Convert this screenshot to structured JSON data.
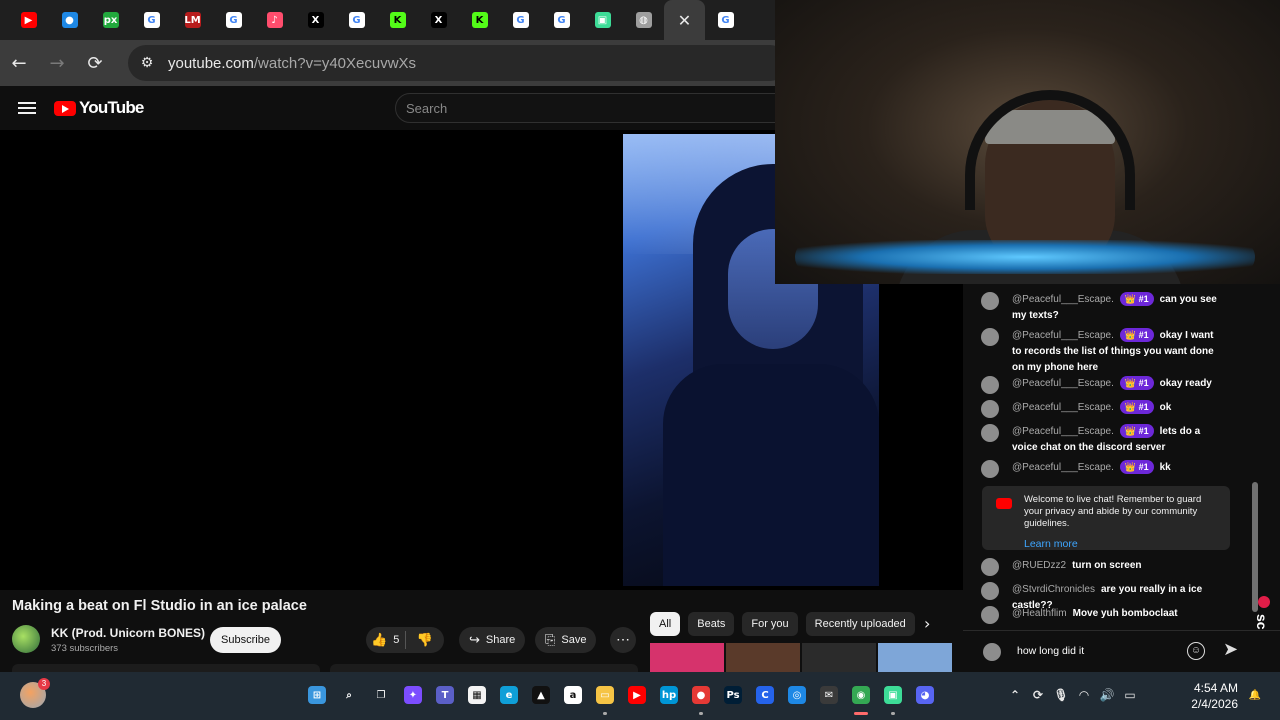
{
  "browser": {
    "tabs": [
      {
        "icon": "youtube-icon",
        "color": "#ff0000",
        "glyph": "▶"
      },
      {
        "icon": "edge-icon",
        "color": "#1e88e5",
        "glyph": "●"
      },
      {
        "icon": "pixlr-icon",
        "color": "#22a93d",
        "glyph": "px"
      },
      {
        "icon": "google-icon",
        "color": "#ffffff",
        "glyph": "G"
      },
      {
        "icon": "lm-icon",
        "color": "#b71c1c",
        "glyph": "LM"
      },
      {
        "icon": "google-icon",
        "color": "#ffffff",
        "glyph": "G"
      },
      {
        "icon": "audio-app-icon",
        "color": "#ff4d6d",
        "glyph": "♪"
      },
      {
        "icon": "x-icon",
        "color": "#000000",
        "glyph": "X"
      },
      {
        "icon": "google-icon",
        "color": "#ffffff",
        "glyph": "G"
      },
      {
        "icon": "kick-icon",
        "color": "#53fc18",
        "glyph": "K"
      },
      {
        "icon": "x-icon",
        "color": "#000000",
        "glyph": "X"
      },
      {
        "icon": "kick-icon",
        "color": "#53fc18",
        "glyph": "K"
      },
      {
        "icon": "google-icon",
        "color": "#ffffff",
        "glyph": "G"
      },
      {
        "icon": "google-icon",
        "color": "#ffffff",
        "glyph": "G"
      },
      {
        "icon": "app-icon",
        "color": "#3ddc97",
        "glyph": "▣"
      },
      {
        "icon": "globe-icon",
        "color": "#9e9e9e",
        "glyph": "◍"
      },
      {
        "icon": "google-icon",
        "color": "#ffffff",
        "glyph": "G"
      }
    ],
    "active_tab_close": "✕",
    "url_domain": "youtube.com",
    "url_path": "/watch?v=y40XecuvwXs"
  },
  "youtube": {
    "logo_text": "YouTube",
    "search_placeholder": "Search"
  },
  "video": {
    "title": "Making a beat on Fl Studio in an ice palace",
    "channel": "KK (Prod. Unicorn BONES)",
    "subscribers": "373 subscribers",
    "subscribe_label": "Subscribe",
    "likes": "5",
    "share_label": "Share",
    "save_label": "Save",
    "more_label": "⋯"
  },
  "recommendations": {
    "chips": [
      "All",
      "Beats",
      "For you",
      "Recently uploaded"
    ],
    "thumb_colors": [
      "#d6336c",
      "#5a3a2a",
      "#2b2b2b",
      "#7ea6d8"
    ]
  },
  "chat": {
    "messages": [
      {
        "author": "@Peaceful___Escape.",
        "badge": "👑 #1",
        "text": "can you see my texts?"
      },
      {
        "author": "@Peaceful___Escape.",
        "badge": "👑 #1",
        "text": "okay I want to records the list of things you want done on my phone here"
      },
      {
        "author": "@Peaceful___Escape.",
        "badge": "👑 #1",
        "text": "okay ready"
      },
      {
        "author": "@Peaceful___Escape.",
        "badge": "👑 #1",
        "text": "ok"
      },
      {
        "author": "@Peaceful___Escape.",
        "badge": "👑 #1",
        "text": "lets do a voice chat on the discord server"
      },
      {
        "author": "@Peaceful___Escape.",
        "badge": "👑 #1",
        "text": "kk"
      },
      {
        "author": "@RUEDzz2",
        "badge": "",
        "text": "turn on screen"
      },
      {
        "author": "@StvrdiChronicles",
        "badge": "",
        "text": "are you really in a ice castle??"
      },
      {
        "author": "@Healthflim",
        "badge": "",
        "text": "Move yuh bomboclaat"
      }
    ],
    "welcome_text": "Welcome to live chat! Remember to guard your privacy and abide by our community guidelines.",
    "learn_more": "Learn more",
    "input_value": "how long did it"
  },
  "overlay": {
    "screenrec_label": "screenrec"
  },
  "taskbar": {
    "weather_badge": "3",
    "time": "4:54 AM",
    "date": "2/4/2026",
    "icons": [
      {
        "name": "start-icon",
        "color": "#3a96dd",
        "glyph": "⊞"
      },
      {
        "name": "search-icon",
        "color": "transparent",
        "glyph": "⌕"
      },
      {
        "name": "task-view-icon",
        "color": "transparent",
        "glyph": "❐"
      },
      {
        "name": "copilot-icon",
        "color": "#7c4dff",
        "glyph": "✦"
      },
      {
        "name": "teams-icon",
        "color": "#5b5fc7",
        "glyph": "T"
      },
      {
        "name": "store-icon",
        "color": "#f4f4f4",
        "glyph": "▦"
      },
      {
        "name": "edge-icon",
        "color": "#0f9fd8",
        "glyph": "e"
      },
      {
        "name": "app-icon",
        "color": "#111111",
        "glyph": "▲"
      },
      {
        "name": "amazon-icon",
        "color": "#ffffff",
        "glyph": "a"
      },
      {
        "name": "file-explorer-icon",
        "color": "#f6c445",
        "glyph": "▭"
      },
      {
        "name": "youtube-icon",
        "color": "#ff0000",
        "glyph": "▶"
      },
      {
        "name": "hp-icon",
        "color": "#0096d6",
        "glyph": "hp"
      },
      {
        "name": "app-icon",
        "color": "#e53935",
        "glyph": "●"
      },
      {
        "name": "photoshop-icon",
        "color": "#001e36",
        "glyph": "Ps"
      },
      {
        "name": "app-icon",
        "color": "#2563eb",
        "glyph": "C"
      },
      {
        "name": "app-icon",
        "color": "#1e88e5",
        "glyph": "◎"
      },
      {
        "name": "app-icon",
        "color": "#3a3a3a",
        "glyph": "✉"
      },
      {
        "name": "chrome-icon",
        "color": "#34a853",
        "glyph": "◉"
      },
      {
        "name": "app-icon",
        "color": "#3ddc97",
        "glyph": "▣"
      },
      {
        "name": "discord-icon",
        "color": "#5865f2",
        "glyph": "◕"
      }
    ],
    "tray": [
      {
        "name": "chevron-up-icon",
        "glyph": "⌃"
      },
      {
        "name": "sync-icon",
        "glyph": "⟳"
      },
      {
        "name": "microphone-icon",
        "glyph": "🎙"
      },
      {
        "name": "wifi-icon",
        "glyph": "◠"
      },
      {
        "name": "volume-icon",
        "glyph": "🔊"
      },
      {
        "name": "battery-icon",
        "glyph": "▭"
      }
    ]
  }
}
